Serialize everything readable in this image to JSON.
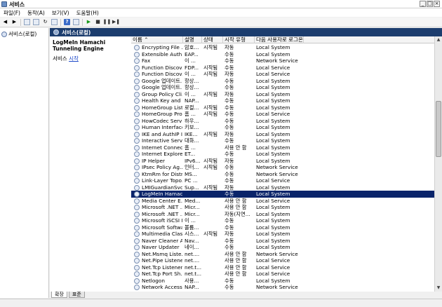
{
  "window": {
    "title": "서비스"
  },
  "menu": [
    "파일(F)",
    "동작(A)",
    "보기(V)",
    "도움말(H)"
  ],
  "toolbar": {
    "icons": [
      "back-icon",
      "forward-icon",
      "console-tree-icon",
      "properties-icon",
      "refresh-icon",
      "export-icon",
      "help-icon",
      "start-icon",
      "stop-icon",
      "pause-icon",
      "resume-icon"
    ]
  },
  "tree": {
    "root_label": "서비스(로컬)"
  },
  "main": {
    "header": "서비스(로컬)",
    "selected_title": "LogMeIn Hamachi Tunneling Engine",
    "action_prefix": "서비스 ",
    "action_link": "시작"
  },
  "columns": [
    "이름",
    "설명",
    "상태",
    "시작 유형",
    "다음 사용자로 로그온"
  ],
  "services": [
    {
      "name": "Encrypting File ...",
      "desc": "암호...",
      "status": "시작됨",
      "startup": "자동",
      "logon": "Local System"
    },
    {
      "name": "Extensible Auth...",
      "desc": "EAP...",
      "status": "",
      "startup": "수동",
      "logon": "Local System"
    },
    {
      "name": "Fax",
      "desc": "이 ...",
      "status": "",
      "startup": "수동",
      "logon": "Network Service"
    },
    {
      "name": "Function Discov...",
      "desc": "FDP...",
      "status": "시작됨",
      "startup": "수동",
      "logon": "Local Service"
    },
    {
      "name": "Function Discov...",
      "desc": "이 ...",
      "status": "시작됨",
      "startup": "자동",
      "logon": "Local Service"
    },
    {
      "name": "Google 업데이트...",
      "desc": "항상...",
      "status": "",
      "startup": "수동",
      "logon": "Local System"
    },
    {
      "name": "Google 업데이트...",
      "desc": "항상...",
      "status": "",
      "startup": "수동",
      "logon": "Local System"
    },
    {
      "name": "Group Policy Cli...",
      "desc": "이 ...",
      "status": "시작됨",
      "startup": "자동",
      "logon": "Local System"
    },
    {
      "name": "Health Key and ...",
      "desc": "NAP...",
      "status": "",
      "startup": "수동",
      "logon": "Local System"
    },
    {
      "name": "HomeGroup List...",
      "desc": "로컬...",
      "status": "시작됨",
      "startup": "수동",
      "logon": "Local System"
    },
    {
      "name": "HomeGroup Pro...",
      "desc": "홈 ...",
      "status": "시작됨",
      "startup": "수동",
      "logon": "Local Service"
    },
    {
      "name": "HowCodec Servi...",
      "desc": "하우...",
      "status": "",
      "startup": "수동",
      "logon": "Local System"
    },
    {
      "name": "Human Interface...",
      "desc": "키보...",
      "status": "",
      "startup": "수동",
      "logon": "Local System"
    },
    {
      "name": "IKE and AuthIP I...",
      "desc": "IKE...",
      "status": "시작됨",
      "startup": "자동",
      "logon": "Local System"
    },
    {
      "name": "Interactive Servi...",
      "desc": "대화...",
      "status": "",
      "startup": "수동",
      "logon": "Local System"
    },
    {
      "name": "Internet Connect...",
      "desc": "홈 ...",
      "status": "",
      "startup": "사용 안 함",
      "logon": "Local System"
    },
    {
      "name": "Internet Explorer...",
      "desc": "ET...",
      "status": "",
      "startup": "수동",
      "logon": "Local System"
    },
    {
      "name": "IP Helper",
      "desc": "IPv6...",
      "status": "시작됨",
      "startup": "자동",
      "logon": "Local System"
    },
    {
      "name": "IPsec Policy Ag...",
      "desc": "인터...",
      "status": "시작됨",
      "startup": "수동",
      "logon": "Network Service"
    },
    {
      "name": "KtmRm for Distri...",
      "desc": "MS...",
      "status": "",
      "startup": "수동",
      "logon": "Network Service"
    },
    {
      "name": "Link-Layer Topo...",
      "desc": "PC ...",
      "status": "",
      "startup": "수동",
      "logon": "Local Service"
    },
    {
      "name": "LMIGuardianSvc",
      "desc": "Sup...",
      "status": "시작됨",
      "startup": "자동",
      "logon": "Local System"
    },
    {
      "name": "LogMeIn Hamac...",
      "desc": "",
      "status": "",
      "startup": "수동",
      "logon": "Local System",
      "selected": true
    },
    {
      "name": "Media Center E...",
      "desc": "Med...",
      "status": "",
      "startup": "사용 안 함",
      "logon": "Local Service"
    },
    {
      "name": "Microsoft .NET ...",
      "desc": "Micr...",
      "status": "",
      "startup": "사용 안 함",
      "logon": "Local System"
    },
    {
      "name": "Microsoft .NET ...",
      "desc": "Micr...",
      "status": "",
      "startup": "자동(지연...",
      "logon": "Local System"
    },
    {
      "name": "Microsoft iSCSI I...",
      "desc": "이 ...",
      "status": "",
      "startup": "수동",
      "logon": "Local System"
    },
    {
      "name": "Microsoft Softwa...",
      "desc": "볼륨...",
      "status": "",
      "startup": "수동",
      "logon": "Local System"
    },
    {
      "name": "Multimedia Clas...",
      "desc": "시스...",
      "status": "시작됨",
      "startup": "자동",
      "logon": "Local System"
    },
    {
      "name": "Naver Cleaner A...",
      "desc": "Nav...",
      "status": "",
      "startup": "수동",
      "logon": "Local System"
    },
    {
      "name": "Naver Updater",
      "desc": "네이...",
      "status": "",
      "startup": "수동",
      "logon": "Local System"
    },
    {
      "name": "Net.Msmq Liste...",
      "desc": "net....",
      "status": "",
      "startup": "사용 안 함",
      "logon": "Network Service"
    },
    {
      "name": "Net.Pipe Listene...",
      "desc": "net....",
      "status": "",
      "startup": "사용 안 함",
      "logon": "Local Service"
    },
    {
      "name": "Net.Tcp Listener...",
      "desc": "net.t...",
      "status": "",
      "startup": "사용 안 함",
      "logon": "Local Service"
    },
    {
      "name": "Net.Tcp Port Sh...",
      "desc": "net.t...",
      "status": "",
      "startup": "사용 안 함",
      "logon": "Local Service"
    },
    {
      "name": "Netlogon",
      "desc": "사용...",
      "status": "",
      "startup": "수동",
      "logon": "Local System"
    },
    {
      "name": "Network Access...",
      "desc": "NAP...",
      "status": "",
      "startup": "수동",
      "logon": "Network Service"
    }
  ],
  "tabs": [
    "확장",
    "표준"
  ]
}
